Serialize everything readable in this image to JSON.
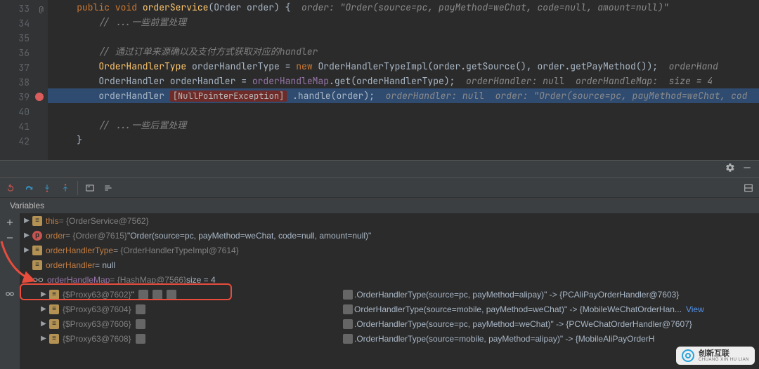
{
  "gutter": {
    "lines": [
      "33",
      "34",
      "35",
      "36",
      "37",
      "38",
      "39",
      "40",
      "41",
      "42"
    ],
    "breakpoint_line_index": 6,
    "at_symbol_line_index": 0
  },
  "code": {
    "l33": {
      "signature_pre": "public void ",
      "fn": "orderService",
      "signature_post": "(Order order) {",
      "hint": "  order: \"Order(source=pc, payMethod=weChat, code=null, amount=null)\""
    },
    "l34": "// ...一些前置处理",
    "l36": "// 通过订单来源确以及支付方式获取对应的handler",
    "l37": {
      "a": "OrderHandlerType",
      "b": " orderHandlerType = ",
      "c": "new",
      "d": " OrderHandlerTypeImpl(order.getSource(), order.getPayMethod());  ",
      "hint": "orderHand"
    },
    "l38": {
      "a": "OrderHandler orderHandler = ",
      "b": "orderHandleMap",
      "c": ".get(orderHandlerType);  ",
      "hint": "orderHandler: null  orderHandleMap:  size = 4"
    },
    "l39": {
      "a": "orderHandler",
      "err": "NullPointerException",
      "b": ".handle(order);  ",
      "hint": "orderHandler: null  order: \"Order(source=pc, payMethod=weChat, cod"
    },
    "l41": "// ...一些后置处理",
    "l42": "}"
  },
  "panel": {
    "variables_title": "Variables",
    "vars": {
      "this_name": "this",
      "this_val": " = {OrderService@7562}",
      "order_name": "order",
      "order_val": " = {Order@7615} ",
      "order_str": "\"Order(source=pc, payMethod=weChat, code=null, amount=null)\"",
      "oht_name": "orderHandlerType",
      "oht_val": " = {OrderHandlerTypeImpl@7614}",
      "oh_name": "orderHandler",
      "oh_val": " = null",
      "ohm_name": "orderHandleMap",
      "ohm_val_a": " = {HashMap@7566}  ",
      "ohm_val_b": "size = 4",
      "entries": [
        {
          "k": "{$Proxy63@7602}",
          "c2": ".OrderHandlerType(source=pc, payMethod=alipay)\" -> {PCAliPayOrderHandler@7603}"
        },
        {
          "k": "{$Proxy63@7604}",
          "c2": "OrderHandlerType(source=mobile, payMethod=weChat)\" -> {MobileWeChatOrderHan...",
          "view": "View"
        },
        {
          "k": "{$Proxy63@7606}",
          "c2": ".OrderHandlerType(source=pc, payMethod=weChat)\" -> {PCWeChatOrderHandler@7607}"
        },
        {
          "k": "{$Proxy63@7608}",
          "c2": ".OrderHandlerType(source=mobile, payMethod=alipay)\" -> {MobileAliPayOrderH"
        }
      ]
    }
  },
  "watermark": {
    "brand": "创新互联",
    "sub": "CHUANG XIN HU LIAN"
  }
}
